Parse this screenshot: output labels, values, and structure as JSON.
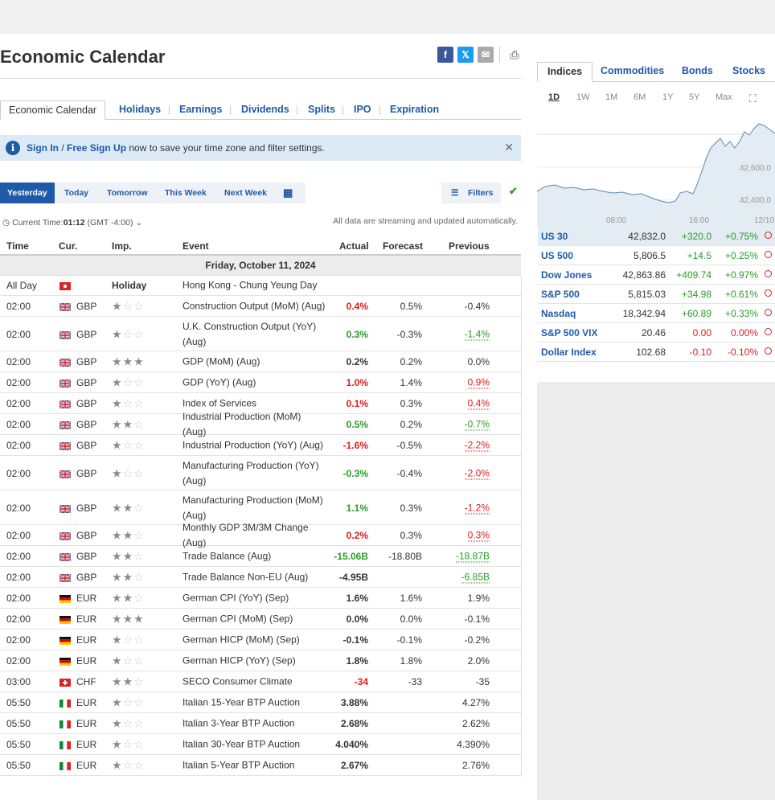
{
  "page": {
    "title": "Economic Calendar",
    "tabs": [
      "Economic Calendar",
      "Holidays",
      "Earnings",
      "Dividends",
      "Splits",
      "IPO",
      "Expiration"
    ],
    "notice": {
      "signin": "Sign In",
      "sep": " / ",
      "signup": "Free Sign Up",
      "rest": " now to save your time zone and filter settings."
    },
    "periods": [
      "Yesterday",
      "Today",
      "Tomorrow",
      "This Week",
      "Next Week"
    ],
    "filters_label": "Filters",
    "current_time_label": "Current Time:",
    "current_time": "01:12",
    "timezone": "(GMT -4:00)",
    "streaming_note": "All data are streaming and updated automatically.",
    "columns": {
      "time": "Time",
      "cur": "Cur.",
      "imp": "Imp.",
      "event": "Event",
      "actual": "Actual",
      "forecast": "Forecast",
      "previous": "Previous"
    },
    "day": "Friday, October 11, 2024"
  },
  "events": [
    {
      "time": "All Day",
      "cur": "",
      "flag": "HK",
      "imp": "Holiday",
      "event": "Hong Kong - Chung Yeung Day",
      "actual": "",
      "forecast": "",
      "previous": ""
    },
    {
      "time": "02:00",
      "cur": "GBP",
      "flag": "GB",
      "imp": 1,
      "event": "Construction Output (MoM) (Aug)",
      "actual": "0.4%",
      "a_color": "red",
      "forecast": "0.5%",
      "previous": "-0.4%"
    },
    {
      "time": "02:00",
      "cur": "GBP",
      "flag": "GB",
      "imp": 1,
      "event": "U.K. Construction Output (YoY) (Aug)",
      "actual": "0.3%",
      "a_color": "green",
      "forecast": "-0.3%",
      "previous": "-1.4%",
      "p_color": "green",
      "p_dot": true
    },
    {
      "time": "02:00",
      "cur": "GBP",
      "flag": "GB",
      "imp": 3,
      "event": "GDP (MoM) (Aug)",
      "actual": "0.2%",
      "forecast": "0.2%",
      "previous": "0.0%"
    },
    {
      "time": "02:00",
      "cur": "GBP",
      "flag": "GB",
      "imp": 1,
      "event": "GDP (YoY) (Aug)",
      "actual": "1.0%",
      "a_color": "red",
      "forecast": "1.4%",
      "previous": "0.9%",
      "p_color": "red",
      "p_dot": true
    },
    {
      "time": "02:00",
      "cur": "GBP",
      "flag": "GB",
      "imp": 1,
      "event": "Index of Services",
      "actual": "0.1%",
      "a_color": "red",
      "forecast": "0.3%",
      "previous": "0.4%",
      "p_color": "red",
      "p_dot": true
    },
    {
      "time": "02:00",
      "cur": "GBP",
      "flag": "GB",
      "imp": 2,
      "event": "Industrial Production (MoM) (Aug)",
      "actual": "0.5%",
      "a_color": "green",
      "forecast": "0.2%",
      "previous": "-0.7%",
      "p_color": "green",
      "p_dot": true
    },
    {
      "time": "02:00",
      "cur": "GBP",
      "flag": "GB",
      "imp": 1,
      "event": "Industrial Production (YoY) (Aug)",
      "actual": "-1.6%",
      "a_color": "red",
      "forecast": "-0.5%",
      "previous": "-2.2%",
      "p_color": "red",
      "p_dot": true
    },
    {
      "time": "02:00",
      "cur": "GBP",
      "flag": "GB",
      "imp": 1,
      "event": "Manufacturing Production (YoY) (Aug)",
      "actual": "-0.3%",
      "a_color": "green",
      "forecast": "-0.4%",
      "previous": "-2.0%",
      "p_color": "red",
      "p_dot": true
    },
    {
      "time": "02:00",
      "cur": "GBP",
      "flag": "GB",
      "imp": 2,
      "event": "Manufacturing Production (MoM) (Aug)",
      "actual": "1.1%",
      "a_color": "green",
      "forecast": "0.3%",
      "previous": "-1.2%",
      "p_color": "red",
      "p_dot": true
    },
    {
      "time": "02:00",
      "cur": "GBP",
      "flag": "GB",
      "imp": 2,
      "event": "Monthly GDP 3M/3M Change (Aug)",
      "actual": "0.2%",
      "a_color": "red",
      "forecast": "0.3%",
      "previous": "0.3%",
      "p_color": "red",
      "p_dot": true
    },
    {
      "time": "02:00",
      "cur": "GBP",
      "flag": "GB",
      "imp": 2,
      "event": "Trade Balance (Aug)",
      "actual": "-15.06B",
      "a_color": "green",
      "forecast": "-18.80B",
      "previous": "-18.87B",
      "p_color": "green",
      "p_dot": true
    },
    {
      "time": "02:00",
      "cur": "GBP",
      "flag": "GB",
      "imp": 2,
      "event": "Trade Balance Non-EU (Aug)",
      "actual": "-4.95B",
      "forecast": "",
      "previous": "-6.85B",
      "p_color": "green",
      "p_dot": true
    },
    {
      "time": "02:00",
      "cur": "EUR",
      "flag": "DE",
      "imp": 2,
      "event": "German CPI (YoY) (Sep)",
      "actual": "1.6%",
      "forecast": "1.6%",
      "previous": "1.9%"
    },
    {
      "time": "02:00",
      "cur": "EUR",
      "flag": "DE",
      "imp": 3,
      "event": "German CPI (MoM) (Sep)",
      "actual": "0.0%",
      "forecast": "0.0%",
      "previous": "-0.1%"
    },
    {
      "time": "02:00",
      "cur": "EUR",
      "flag": "DE",
      "imp": 1,
      "event": "German HICP (MoM) (Sep)",
      "actual": "-0.1%",
      "forecast": "-0.1%",
      "previous": "-0.2%"
    },
    {
      "time": "02:00",
      "cur": "EUR",
      "flag": "DE",
      "imp": 1,
      "event": "German HICP (YoY) (Sep)",
      "actual": "1.8%",
      "forecast": "1.8%",
      "previous": "2.0%"
    },
    {
      "time": "03:00",
      "cur": "CHF",
      "flag": "CH",
      "imp": 2,
      "event": "SECO Consumer Climate",
      "actual": "-34",
      "a_color": "red",
      "forecast": "-33",
      "previous": "-35"
    },
    {
      "time": "05:50",
      "cur": "EUR",
      "flag": "IT",
      "imp": 1,
      "event": "Italian 15-Year BTP Auction",
      "actual": "3.88%",
      "forecast": "",
      "previous": "4.27%"
    },
    {
      "time": "05:50",
      "cur": "EUR",
      "flag": "IT",
      "imp": 1,
      "event": "Italian 3-Year BTP Auction",
      "actual": "2.68%",
      "forecast": "",
      "previous": "2.62%"
    },
    {
      "time": "05:50",
      "cur": "EUR",
      "flag": "IT",
      "imp": 1,
      "event": "Italian 30-Year BTP Auction",
      "actual": "4.040%",
      "forecast": "",
      "previous": "4.390%"
    },
    {
      "time": "05:50",
      "cur": "EUR",
      "flag": "IT",
      "imp": 1,
      "event": "Italian 5-Year BTP Auction",
      "actual": "2.67%",
      "forecast": "",
      "previous": "2.76%"
    }
  ],
  "sidebar": {
    "tabs": [
      "Indices",
      "Commodities",
      "Bonds",
      "Stocks"
    ],
    "ranges": [
      "1D",
      "1W",
      "1M",
      "6M",
      "1Y",
      "5Y",
      "Max"
    ],
    "chart": {
      "y_labels": [
        "42,600.0",
        "42,400.0"
      ],
      "x_labels": [
        "08:00",
        "16:00",
        "12/10"
      ]
    },
    "indices": [
      {
        "name": "US 30",
        "last": "42,832.0",
        "chg": "+320.0",
        "pct": "+0.75%",
        "color": "green"
      },
      {
        "name": "US 500",
        "last": "5,806.5",
        "chg": "+14.5",
        "pct": "+0.25%",
        "color": "green"
      },
      {
        "name": "Dow Jones",
        "last": "42,863.86",
        "chg": "+409.74",
        "pct": "+0.97%",
        "color": "green"
      },
      {
        "name": "S&P 500",
        "last": "5,815.03",
        "chg": "+34.98",
        "pct": "+0.61%",
        "color": "green"
      },
      {
        "name": "Nasdaq",
        "last": "18,342.94",
        "chg": "+60.89",
        "pct": "+0.33%",
        "color": "green"
      },
      {
        "name": "S&P 500 VIX",
        "last": "20.46",
        "chg": "0.00",
        "pct": "0.00%",
        "color": "red"
      },
      {
        "name": "Dollar Index",
        "last": "102.68",
        "chg": "-0.10",
        "pct": "-0.10%",
        "color": "red"
      }
    ]
  },
  "colors": {
    "accent": "#1e5aa8",
    "green": "#2a9d2a",
    "red": "#e01b1b"
  }
}
